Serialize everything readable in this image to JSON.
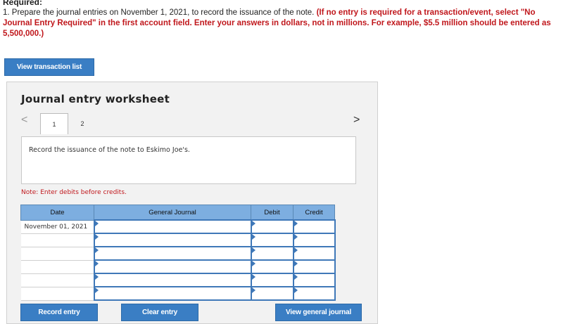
{
  "required": {
    "heading": "Required:",
    "instruction_plain": "1. Prepare the journal entries on November 1, 2021, to record the issuance of the note.",
    "instruction_red": "(If no entry is required for a transaction/event, select \"No Journal Entry Required\" in the first account field. Enter your answers in dollars, not in millions. For example, $5.5 million should be entered as 5,500,000.)"
  },
  "view_transaction_list_label": "View transaction list",
  "worksheet": {
    "title": "Journal entry worksheet",
    "prev_glyph": "<",
    "next_glyph": ">",
    "tabs": [
      {
        "label": "1",
        "active": true
      },
      {
        "label": "2",
        "active": false
      }
    ],
    "description": "Record the issuance of the note to Eskimo Joe's.",
    "note": "Note: Enter debits before credits.",
    "table": {
      "headers": [
        "Date",
        "General Journal",
        "Debit",
        "Credit"
      ],
      "rows": [
        {
          "date": "November 01, 2021"
        },
        {
          "date": ""
        },
        {
          "date": ""
        },
        {
          "date": ""
        },
        {
          "date": ""
        },
        {
          "date": ""
        }
      ]
    }
  },
  "buttons": {
    "record_entry": "Record entry",
    "clear_entry": "Clear entry",
    "view_general_journal": "View general journal"
  },
  "colors": {
    "accent_button": "#3a7ec4",
    "header_blue": "#7daee0",
    "note_red": "#c0171c"
  }
}
